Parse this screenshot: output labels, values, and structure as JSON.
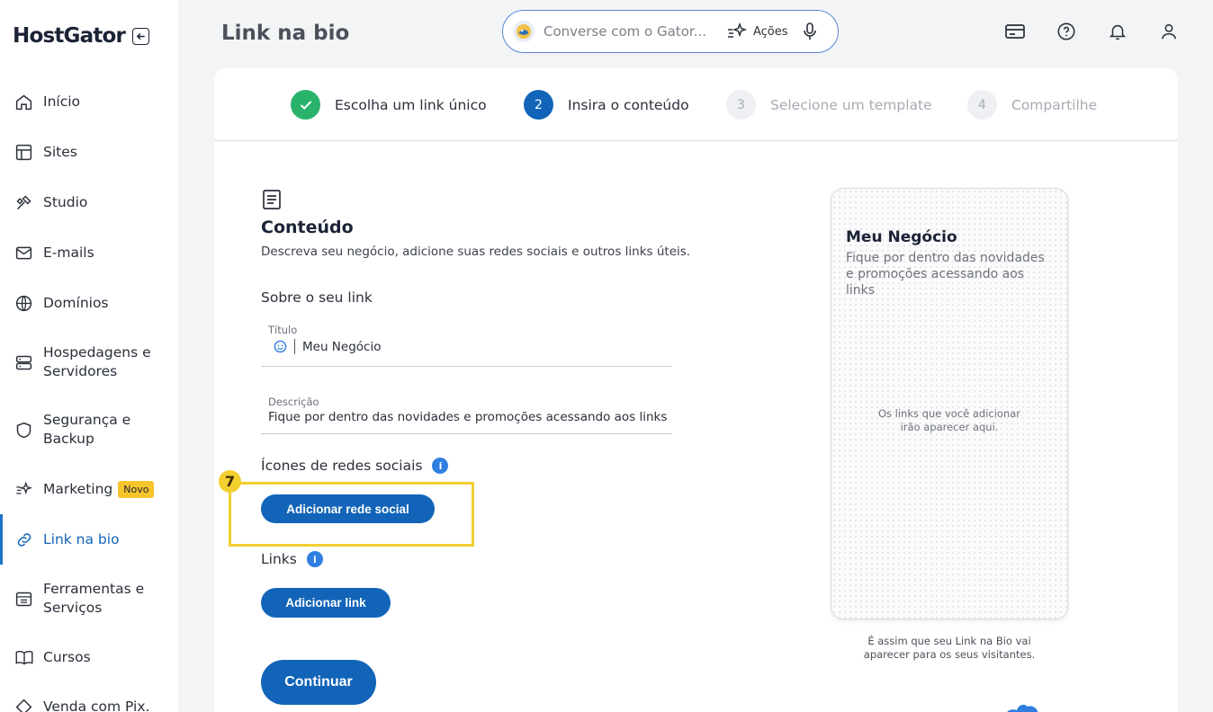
{
  "app": {
    "logo": "HostGator",
    "page_title": "Link na bio"
  },
  "sidebar": {
    "items": [
      {
        "label": "Início",
        "icon": "home-icon"
      },
      {
        "label": "Sites",
        "icon": "layout-icon"
      },
      {
        "label": "Studio",
        "icon": "tools-icon"
      },
      {
        "label": "E-mails",
        "icon": "mail-icon"
      },
      {
        "label": "Domínios",
        "icon": "globe-icon"
      },
      {
        "label": "Hospedagens e Servidores",
        "icon": "server-icon"
      },
      {
        "label": "Segurança e Backup",
        "icon": "shield-icon"
      },
      {
        "label": "Marketing",
        "icon": "sparkle-icon",
        "badge": "Novo"
      },
      {
        "label": "Link na bio",
        "icon": "link-icon",
        "active": true
      },
      {
        "label": "Ferramentas e Serviços",
        "icon": "toolbox-icon"
      },
      {
        "label": "Cursos",
        "icon": "book-icon"
      },
      {
        "label": "Venda com Pix.",
        "icon": "pix-icon"
      }
    ]
  },
  "header": {
    "chat_placeholder": "Converse com o Gator...",
    "actions_label": "Ações"
  },
  "stepper": {
    "steps": [
      {
        "number": "1",
        "label": "Escolha um link único",
        "state": "done"
      },
      {
        "number": "2",
        "label": "Insira o conteúdo",
        "state": "current"
      },
      {
        "number": "3",
        "label": "Selecione um template",
        "state": "pending"
      },
      {
        "number": "4",
        "label": "Compartilhe",
        "state": "pending"
      }
    ]
  },
  "content": {
    "title": "Conteúdo",
    "description": "Descreva seu negócio, adicione suas redes sociais e outros links úteis.",
    "about_heading": "Sobre o seu link",
    "title_field": {
      "label": "Título",
      "value": "Meu Negócio"
    },
    "description_field": {
      "label": "Descrição",
      "value": "Fique por dentro das novidades e promoções acessando aos links"
    },
    "social_heading": "Ícones de redes sociais",
    "add_social_button": "Adicionar rede social",
    "links_heading": "Links",
    "add_link_button": "Adicionar link",
    "continue_button": "Continuar",
    "highlight_marker": "7"
  },
  "preview": {
    "title": "Meu Negócio",
    "description": "Fique por dentro das novidades e promoções acessando aos links",
    "empty_text": "Os links que você adicionar irão aparecer aqui.",
    "caption": "É assim que seu Link na Bio vai aparecer para os seus visitantes."
  },
  "colors": {
    "primary": "#1264b8",
    "success": "#29b26b",
    "highlight": "#f1cf2f",
    "badge": "#f6c42b"
  }
}
